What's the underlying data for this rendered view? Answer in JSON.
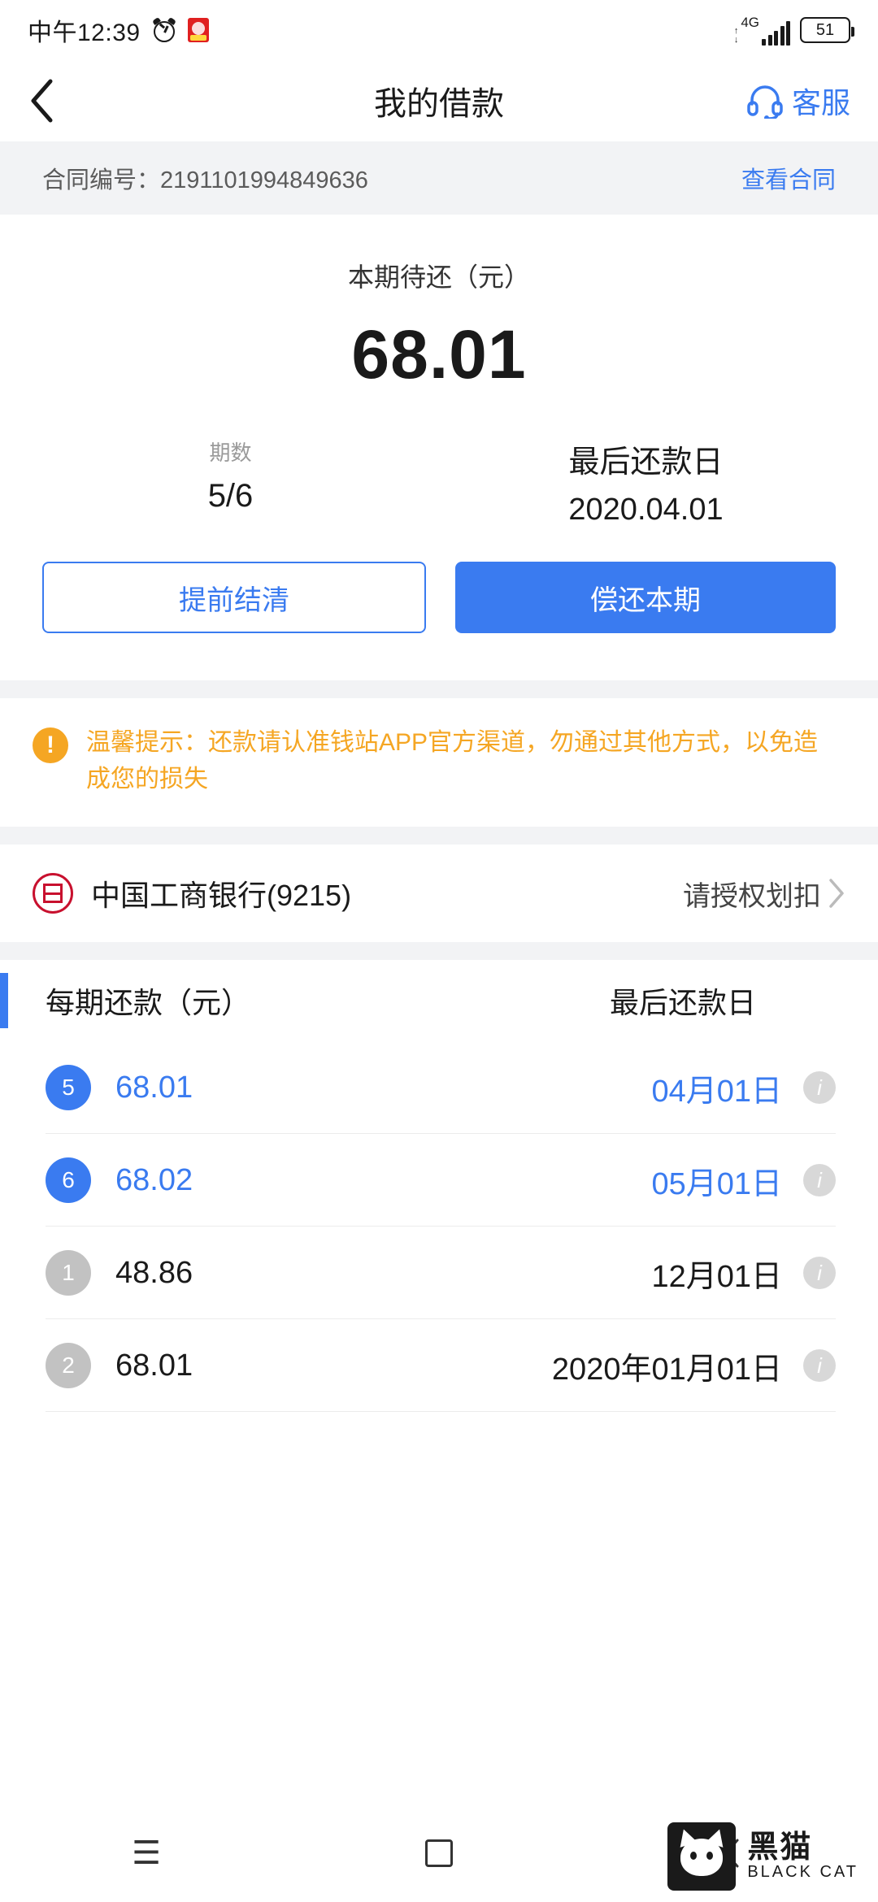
{
  "status_bar": {
    "time": "中午12:39",
    "alarm_icon": "alarm-clock-icon",
    "app_icon": "red-app-icon",
    "network_label": "4G",
    "battery_level": "51"
  },
  "nav": {
    "back_icon": "back-chevron-icon",
    "title": "我的借款",
    "service_icon": "headset-icon",
    "service_label": "客服"
  },
  "contract": {
    "label": "合同编号：2191101994849636",
    "view_link": "查看合同"
  },
  "summary": {
    "amount_label": "本期待还（元）",
    "amount_value": "68.01",
    "period_label": "期数",
    "period_value": "5/6",
    "due_label": "最后还款日",
    "due_value": "2020.04.01",
    "settle_early_button": "提前结清",
    "repay_button": "偿还本期"
  },
  "tip": {
    "icon": "warning-exclamation-icon",
    "text": "温馨提示：还款请认准钱站APP官方渠道，勿通过其他方式，以免造成您的损失"
  },
  "bank": {
    "logo": "icbc-bank-icon",
    "name": "中国工商银行(9215)",
    "action": "请授权划扣",
    "chevron": "chevron-right-icon"
  },
  "schedule": {
    "header_amount": "每期还款（元）",
    "header_date": "最后还款日",
    "rows": [
      {
        "index": "5",
        "amount": "68.01",
        "date": "04月01日",
        "state": "active",
        "info_icon": "info-icon"
      },
      {
        "index": "6",
        "amount": "68.02",
        "date": "05月01日",
        "state": "active",
        "info_icon": "info-icon"
      },
      {
        "index": "1",
        "amount": "48.86",
        "date": "12月01日",
        "state": "past",
        "info_icon": "info-icon"
      },
      {
        "index": "2",
        "amount": "68.01",
        "date": "2020年01月01日",
        "state": "past",
        "info_icon": "info-icon"
      }
    ]
  },
  "bottom_nav": {
    "menu_icon": "menu-icon",
    "home_icon": "home-square-icon",
    "back_icon": "back-chevron-icon"
  },
  "watermark": {
    "cn": "黑猫",
    "en": "BLACK CAT",
    "logo": "black-cat-logo-icon"
  },
  "colors": {
    "accent": "#3a7bf0",
    "warning": "#f5a623",
    "page_bg": "#f2f3f5"
  }
}
